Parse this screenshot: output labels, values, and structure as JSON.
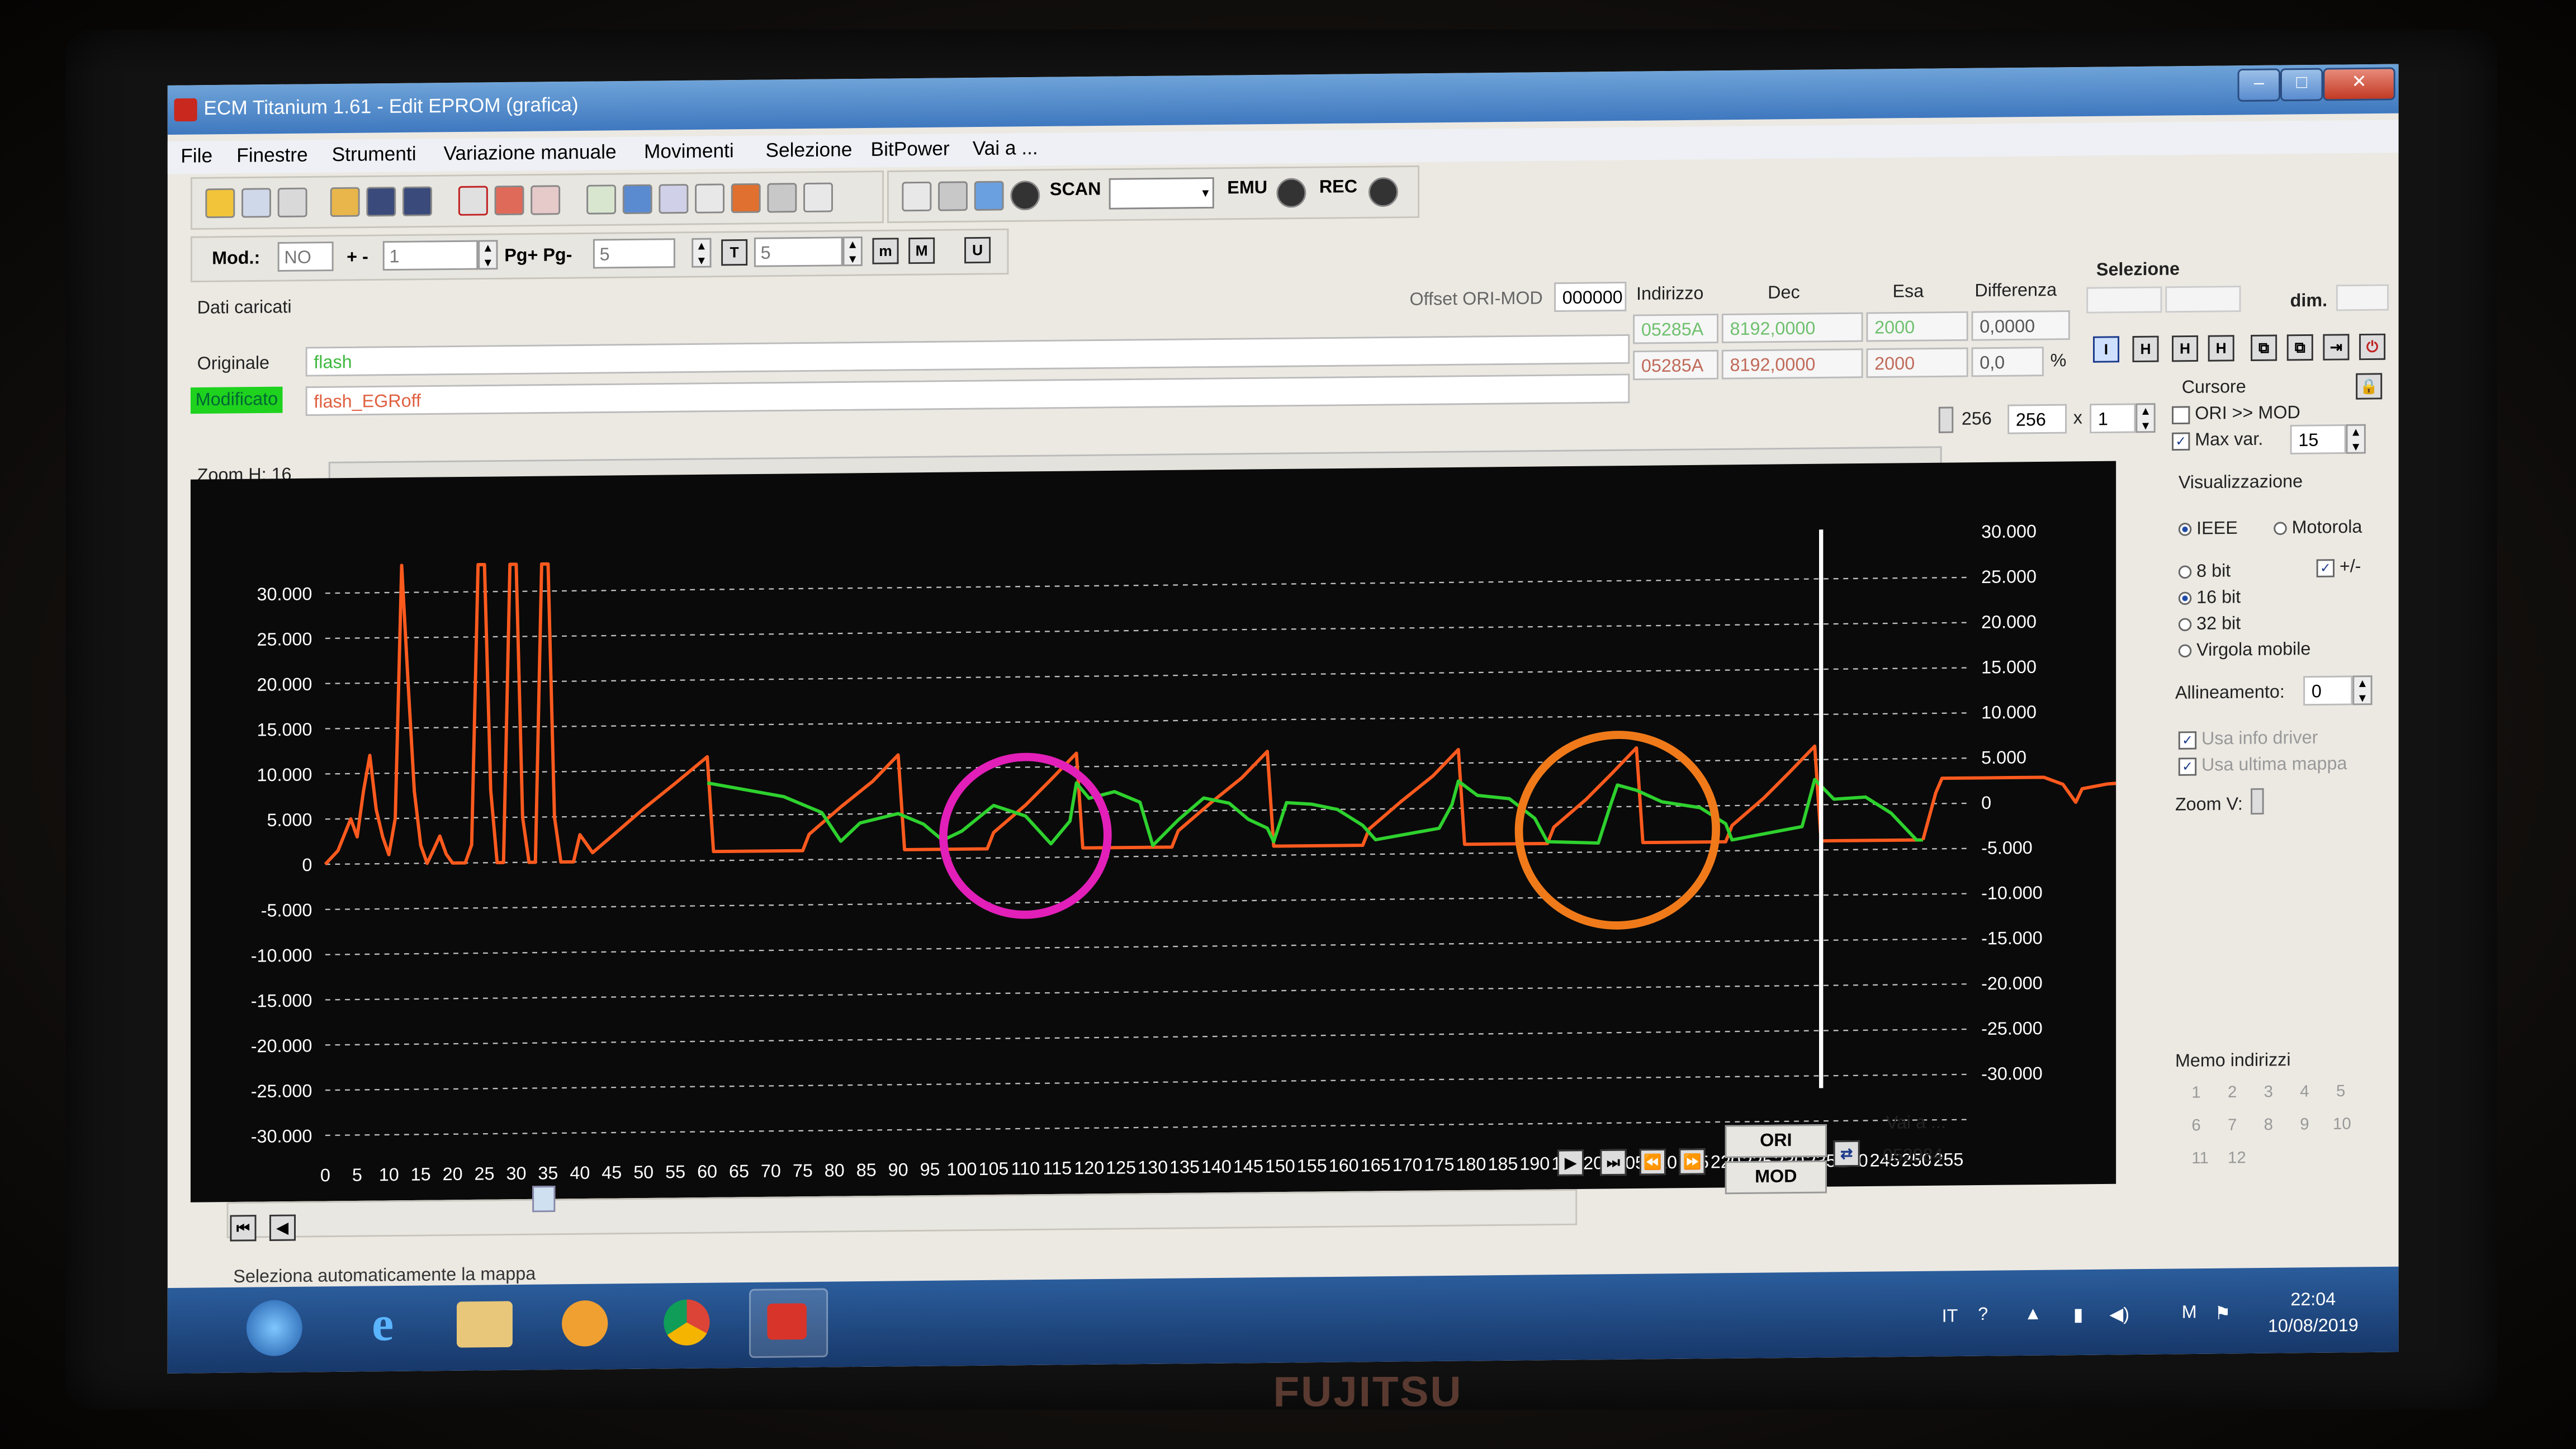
{
  "window": {
    "title": "ECM Titanium 1.61 - Edit EPROM (grafica)",
    "min": "–",
    "max": "□",
    "close": "✕"
  },
  "menu": [
    "File",
    "Finestre",
    "Strumenti",
    "Variazione manuale",
    "Movimenti",
    "Selezione",
    "BitPower",
    "Vai a ..."
  ],
  "toolbar": {
    "scan": "SCAN",
    "emu": "EMU",
    "rec": "REC"
  },
  "row2": {
    "mod_label": "Mod.:",
    "mod_value": "NO",
    "plusminus_label": "+ -",
    "plusminus_value": "1",
    "pg_label": "Pg+ Pg-",
    "pg_value": "5",
    "t_value": "5"
  },
  "data": {
    "dati_caricati": "Dati caricati",
    "offset_label": "Offset ORI-MOD",
    "offset_value": "000000",
    "headers": {
      "indirizzo": "Indirizzo",
      "dec": "Dec",
      "esa": "Esa",
      "differenza": "Differenza"
    },
    "originale": {
      "label": "Originale",
      "file": "flash",
      "indirizzo": "05285A",
      "dec": "8192,0000",
      "esa": "2000",
      "diff": "0,0000"
    },
    "modificato": {
      "label": "Modificato",
      "file": "flash_EGRoff",
      "indirizzo": "05285A",
      "dec": "8192,0000",
      "esa": "2000",
      "diff": "0,0",
      "pct": "%"
    }
  },
  "zoom": {
    "label": "Zoom H: 16",
    "v1": "256",
    "v2": "256",
    "x": "x",
    "mult": "1"
  },
  "selezione": {
    "title": "Selezione",
    "dim": "dim."
  },
  "cursore": {
    "title": "Cursore",
    "ori_mod": "ORI >> MOD",
    "max_var_label": "Max var.",
    "max_var_value": "15"
  },
  "visualizzazione": {
    "title": "Visualizzazione",
    "ieee": "IEEE",
    "motorola": "Motorola",
    "b8": "8 bit",
    "b16": "16 bit",
    "b32": "32 bit",
    "virgola": "Virgola mobile",
    "plusminus": "+/-",
    "allineamento_label": "Allineamento:",
    "allineamento_value": "0",
    "info_driver": "Usa info driver",
    "ultima_mappa": "Usa ultima mappa",
    "zoom_v": "Zoom V:"
  },
  "memo": {
    "title": "Memo indirizzi",
    "nums": [
      "1",
      "2",
      "3",
      "4",
      "5",
      "6",
      "7",
      "8",
      "9",
      "10",
      "11",
      "12"
    ]
  },
  "nav": {
    "ori": "ORI",
    "mod": "MOD",
    "vai_a": "Vai a ...",
    "address": "052984"
  },
  "status_text": "Seleziona automaticamente la mappa",
  "tray": {
    "lang": "IT",
    "time": "22:04",
    "date": "10/08/2019"
  },
  "colors": {
    "original": "#ff5a1e",
    "modified": "#2ed12e",
    "grid": "#bfbfbf",
    "cursor": "#ffffff",
    "circle_magenta": "#e21fb8",
    "circle_orange": "#f07a1a",
    "modificato_bg": "#1ed21e"
  },
  "chart_data": {
    "type": "line",
    "xlim": [
      0,
      255
    ],
    "ylim": [
      -30000,
      30000
    ],
    "x_ticks": [
      0,
      5,
      10,
      15,
      20,
      25,
      30,
      35,
      40,
      45,
      50,
      55,
      60,
      65,
      70,
      75,
      80,
      85,
      90,
      95,
      100,
      105,
      110,
      115,
      120,
      125,
      130,
      135,
      140,
      145,
      150,
      155,
      160,
      165,
      170,
      175,
      180,
      185,
      190,
      195,
      200,
      205,
      210,
      215,
      220,
      225,
      230,
      235,
      240,
      245,
      250,
      255
    ],
    "y_ticks_left": [
      "30.000",
      "25.000",
      "20.000",
      "15.000",
      "10.000",
      "5.000",
      "0",
      "-5.000",
      "-10.000",
      "-15.000",
      "-20.000",
      "-25.000",
      "-30.000"
    ],
    "y_ticks_right": [
      "30.000",
      "25.000",
      "20.000",
      "15.000",
      "10.000",
      "5.000",
      "0",
      "-5.000",
      "-10.000",
      "-15.000",
      "-20.000",
      "-25.000",
      "-30.000"
    ],
    "cursor_x": 235,
    "series": [
      {
        "values": [
          [
            0,
            0
          ],
          [
            2,
            1500
          ],
          [
            4,
            5000
          ],
          [
            5,
            3000
          ],
          [
            6,
            8000
          ],
          [
            7,
            12000
          ],
          [
            8,
            6000
          ],
          [
            9,
            3000
          ],
          [
            10,
            1000
          ],
          [
            11,
            5000
          ],
          [
            12,
            33000
          ],
          [
            13,
            20000
          ],
          [
            14,
            8000
          ],
          [
            15,
            2000
          ],
          [
            16,
            0
          ],
          [
            17,
            1500
          ],
          [
            18,
            3000
          ],
          [
            19,
            1000
          ],
          [
            20,
            0
          ],
          [
            21,
            0
          ],
          [
            22,
            0
          ],
          [
            23,
            2000
          ],
          [
            24,
            33000
          ],
          [
            25,
            33000
          ],
          [
            26,
            8000
          ],
          [
            27,
            0
          ],
          [
            28,
            0
          ],
          [
            29,
            33000
          ],
          [
            30,
            33000
          ],
          [
            31,
            5000
          ],
          [
            32,
            0
          ],
          [
            33,
            0
          ],
          [
            34,
            33000
          ],
          [
            35,
            33000
          ],
          [
            36,
            5000
          ],
          [
            37,
            0
          ],
          [
            38,
            0
          ],
          [
            39,
            0
          ],
          [
            40,
            3000
          ],
          [
            41,
            2000
          ],
          [
            42,
            1000
          ],
          [
            45,
            2800
          ],
          [
            50,
            5800
          ],
          [
            55,
            8600
          ],
          [
            60,
            11500
          ],
          [
            61,
            1000
          ],
          [
            75,
            1000
          ],
          [
            76,
            2800
          ],
          [
            81,
            5800
          ],
          [
            86,
            8600
          ],
          [
            90,
            11500
          ],
          [
            91,
            1000
          ],
          [
            104,
            1000
          ],
          [
            105,
            2800
          ],
          [
            110,
            5800
          ],
          [
            114,
            8600
          ],
          [
            118,
            11500
          ],
          [
            119,
            1000
          ],
          [
            133,
            1000
          ],
          [
            134,
            2800
          ],
          [
            139,
            5800
          ],
          [
            144,
            8600
          ],
          [
            148,
            11500
          ],
          [
            149,
            1000
          ],
          [
            163,
            1000
          ],
          [
            164,
            2800
          ],
          [
            169,
            5800
          ],
          [
            174,
            8600
          ],
          [
            178,
            11500
          ],
          [
            179,
            1000
          ],
          [
            192,
            1000
          ],
          [
            193,
            2800
          ],
          [
            198,
            5800
          ],
          [
            202,
            8600
          ],
          [
            206,
            11500
          ],
          [
            207,
            1000
          ],
          [
            220,
            1000
          ],
          [
            221,
            2800
          ],
          [
            226,
            5800
          ],
          [
            230,
            8600
          ],
          [
            234,
            11500
          ],
          [
            235,
            1000
          ],
          [
            251,
            1000
          ]
        ]
      },
      {
        "values": [
          [
            60,
            8600
          ],
          [
            66,
            7800
          ],
          [
            72,
            7000
          ],
          [
            78,
            5200
          ],
          [
            81,
            2000
          ],
          [
            84,
            4000
          ],
          [
            90,
            5000
          ],
          [
            94,
            3800
          ],
          [
            97,
            2000
          ],
          [
            100,
            3000
          ],
          [
            105,
            5800
          ],
          [
            110,
            4600
          ],
          [
            114,
            1500
          ],
          [
            117,
            4000
          ],
          [
            118,
            8200
          ],
          [
            120,
            6500
          ],
          [
            124,
            7200
          ],
          [
            128,
            6000
          ],
          [
            130,
            1200
          ],
          [
            134,
            4000
          ],
          [
            138,
            6400
          ],
          [
            142,
            5800
          ],
          [
            145,
            4000
          ],
          [
            148,
            3000
          ],
          [
            149,
            1500
          ],
          [
            151,
            5800
          ],
          [
            155,
            5600
          ],
          [
            159,
            5000
          ],
          [
            163,
            3200
          ],
          [
            165,
            1600
          ],
          [
            175,
            2800
          ],
          [
            177,
            5400
          ],
          [
            178,
            8000
          ],
          [
            181,
            6400
          ],
          [
            186,
            6000
          ],
          [
            190,
            3800
          ],
          [
            192,
            1200
          ],
          [
            200,
            1000
          ],
          [
            202,
            5400
          ],
          [
            203,
            7400
          ],
          [
            206,
            6800
          ],
          [
            210,
            5500
          ],
          [
            216,
            4800
          ],
          [
            220,
            3000
          ],
          [
            221,
            1200
          ],
          [
            232,
            2600
          ],
          [
            233,
            5200
          ],
          [
            234,
            7800
          ],
          [
            237,
            5600
          ],
          [
            242,
            5800
          ],
          [
            246,
            4000
          ],
          [
            250,
            1000
          ],
          [
            251,
            1000
          ]
        ]
      },
      {
        "values": [
          [
            251,
            1000
          ],
          [
            253,
            6200
          ],
          [
            254,
            7800
          ],
          [
            255,
            7800
          ],
          [
            260,
            7800
          ],
          [
            265,
            7800
          ],
          [
            270,
            7800
          ],
          [
            273,
            7000
          ],
          [
            275,
            5000
          ],
          [
            276,
            6500
          ],
          [
            280,
            7000
          ],
          [
            285,
            7200
          ],
          [
            288,
            5200
          ],
          [
            289,
            4000
          ],
          [
            290,
            6400
          ],
          [
            300,
            7200
          ],
          [
            310,
            7600
          ],
          [
            320,
            8000
          ]
        ]
      }
    ]
  }
}
